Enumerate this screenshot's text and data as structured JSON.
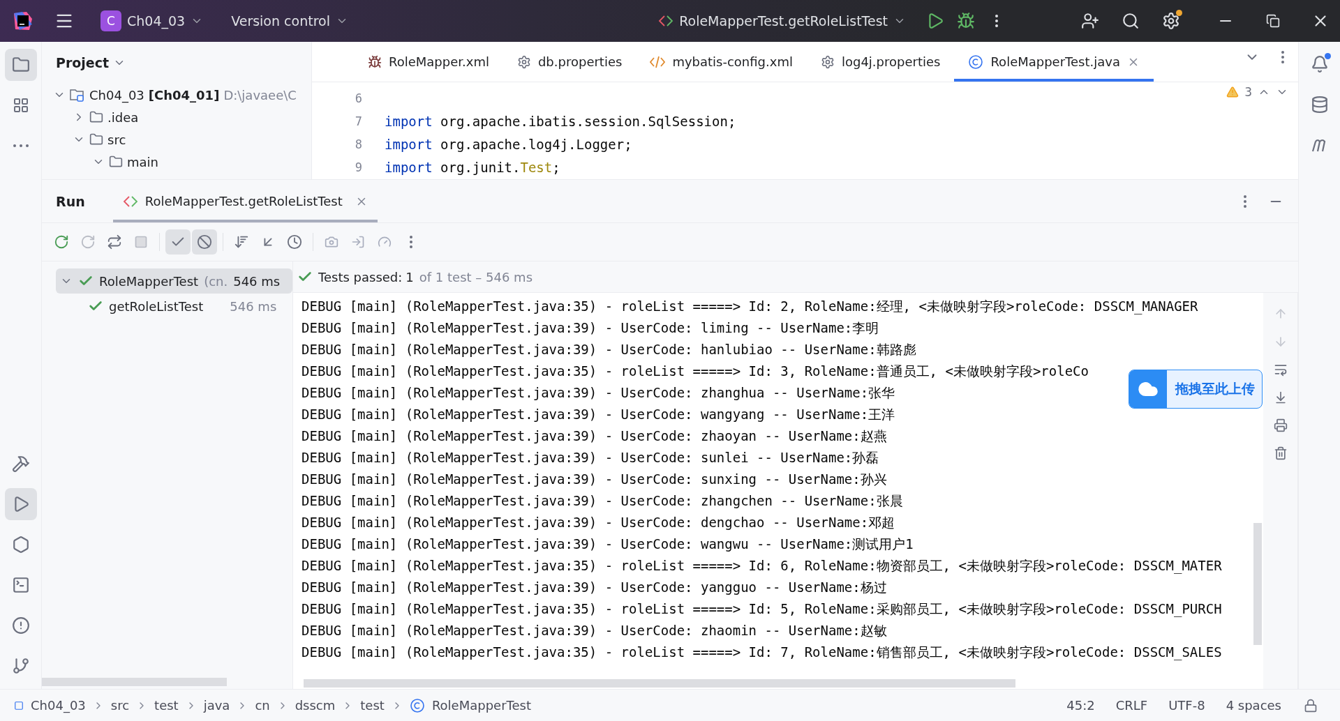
{
  "title_bar": {
    "project_badge": "C",
    "project": "Ch04_03",
    "vcs": "Version control",
    "run_config": "RoleMapperTest.getRoleListTest"
  },
  "left_tools": [
    {
      "kind": "project",
      "selected": true
    },
    {
      "kind": "structure",
      "selected": false
    },
    {
      "kind": "more",
      "selected": false
    },
    {
      "kind": "build",
      "selected": false
    },
    {
      "kind": "run",
      "selected": true
    },
    {
      "kind": "services",
      "selected": false
    },
    {
      "kind": "terminal",
      "selected": false
    },
    {
      "kind": "problems",
      "selected": false
    },
    {
      "kind": "git",
      "selected": false
    }
  ],
  "project_panel": {
    "title": "Project",
    "tree": [
      {
        "label": "Ch04_03",
        "module": "[Ch04_01]",
        "path": "D:\\javaee\\C",
        "kind": "module",
        "expanded": true,
        "children": [
          {
            "label": ".idea",
            "kind": "folder",
            "expanded": false
          },
          {
            "label": "src",
            "kind": "folder",
            "expanded": true,
            "children": [
              {
                "label": "main",
                "kind": "folder",
                "expanded": true
              }
            ]
          }
        ]
      }
    ]
  },
  "editor": {
    "tabs": [
      {
        "label": "RoleMapper.xml",
        "kind": "xml",
        "selected": false
      },
      {
        "label": "db.properties",
        "kind": "properties",
        "selected": false
      },
      {
        "label": "mybatis-config.xml",
        "kind": "config",
        "selected": false
      },
      {
        "label": "log4j.properties",
        "kind": "properties",
        "selected": false
      },
      {
        "label": "RoleMapperTest.java",
        "kind": "class",
        "selected": true
      }
    ],
    "warnings": "3",
    "lines": [
      {
        "number": "6"
      },
      {
        "number": "7",
        "tokens": [
          {
            "text": "import",
            "kind": "keyword"
          },
          {
            "text": " org.apache.ibatis.session.SqlSession;",
            "kind": "plain"
          }
        ]
      },
      {
        "number": "8",
        "tokens": [
          {
            "text": "import",
            "kind": "keyword"
          },
          {
            "text": " org.apache.log4j.Logger;",
            "kind": "plain"
          }
        ]
      },
      {
        "number": "9",
        "tokens": [
          {
            "text": "import",
            "kind": "keyword"
          },
          {
            "text": " org.junit.",
            "kind": "plain"
          },
          {
            "text": "Test",
            "kind": "annotation"
          },
          {
            "text": ";",
            "kind": "plain"
          }
        ]
      }
    ]
  },
  "run_panel": {
    "title": "Run",
    "tabs": [
      {
        "label": "RoleMapperTest.getRoleListTest",
        "selected": true
      }
    ],
    "filters": [
      {
        "kind": "passed",
        "on": true
      },
      {
        "kind": "ignored",
        "on": true
      }
    ],
    "tests": [
      {
        "name": "RoleMapperTest",
        "detail": "(cn.",
        "time": "546 ms",
        "passed": true,
        "selected": true,
        "expanded": true,
        "children": [
          {
            "name": "getRoleListTest",
            "time": "546 ms",
            "passed": true,
            "selected": false
          }
        ]
      }
    ],
    "status": {
      "label": "Tests passed:",
      "count": "1",
      "rest": "of 1 test – 546 ms"
    },
    "console": [
      "DEBUG [main] (RoleMapperTest.java:35) - roleList =====> Id: 2, RoleName:经理, <未做映射字段>roleCode: DSSCM_MANAGER",
      "DEBUG [main] (RoleMapperTest.java:39) - UserCode: liming -- UserName:李明",
      "DEBUG [main] (RoleMapperTest.java:39) - UserCode: hanlubiao -- UserName:韩路彪",
      "DEBUG [main] (RoleMapperTest.java:35) - roleList =====> Id: 3, RoleName:普通员工, <未做映射字段>roleCo",
      "DEBUG [main] (RoleMapperTest.java:39) - UserCode: zhanghua -- UserName:张华",
      "DEBUG [main] (RoleMapperTest.java:39) - UserCode: wangyang -- UserName:王洋",
      "DEBUG [main] (RoleMapperTest.java:39) - UserCode: zhaoyan -- UserName:赵燕",
      "DEBUG [main] (RoleMapperTest.java:39) - UserCode: sunlei -- UserName:孙磊",
      "DEBUG [main] (RoleMapperTest.java:39) - UserCode: sunxing -- UserName:孙兴",
      "DEBUG [main] (RoleMapperTest.java:39) - UserCode: zhangchen -- UserName:张晨",
      "DEBUG [main] (RoleMapperTest.java:39) - UserCode: dengchao -- UserName:邓超",
      "DEBUG [main] (RoleMapperTest.java:39) - UserCode: wangwu -- UserName:测试用户1",
      "DEBUG [main] (RoleMapperTest.java:35) - roleList =====> Id: 6, RoleName:物资部员工, <未做映射字段>roleCode: DSSCM_MATER",
      "DEBUG [main] (RoleMapperTest.java:39) - UserCode: yangguo -- UserName:杨过",
      "DEBUG [main] (RoleMapperTest.java:35) - roleList =====> Id: 5, RoleName:采购部员工, <未做映射字段>roleCode: DSSCM_PURCH",
      "DEBUG [main] (RoleMapperTest.java:39) - UserCode: zhaomin -- UserName:赵敏",
      "DEBUG [main] (RoleMapperTest.java:35) - roleList =====> Id: 7, RoleName:销售部员工, <未做映射字段>roleCode: DSSCM_SALES"
    ]
  },
  "upload_widget": {
    "label": "拖拽至此上传"
  },
  "status_bar": {
    "breadcrumbs": [
      "Ch04_03",
      "src",
      "test",
      "java",
      "cn",
      "dsscm",
      "test",
      "RoleMapperTest"
    ],
    "position": "45:2",
    "line_endings": "CRLF",
    "encoding": "UTF-8",
    "indent": "4 spaces"
  }
}
